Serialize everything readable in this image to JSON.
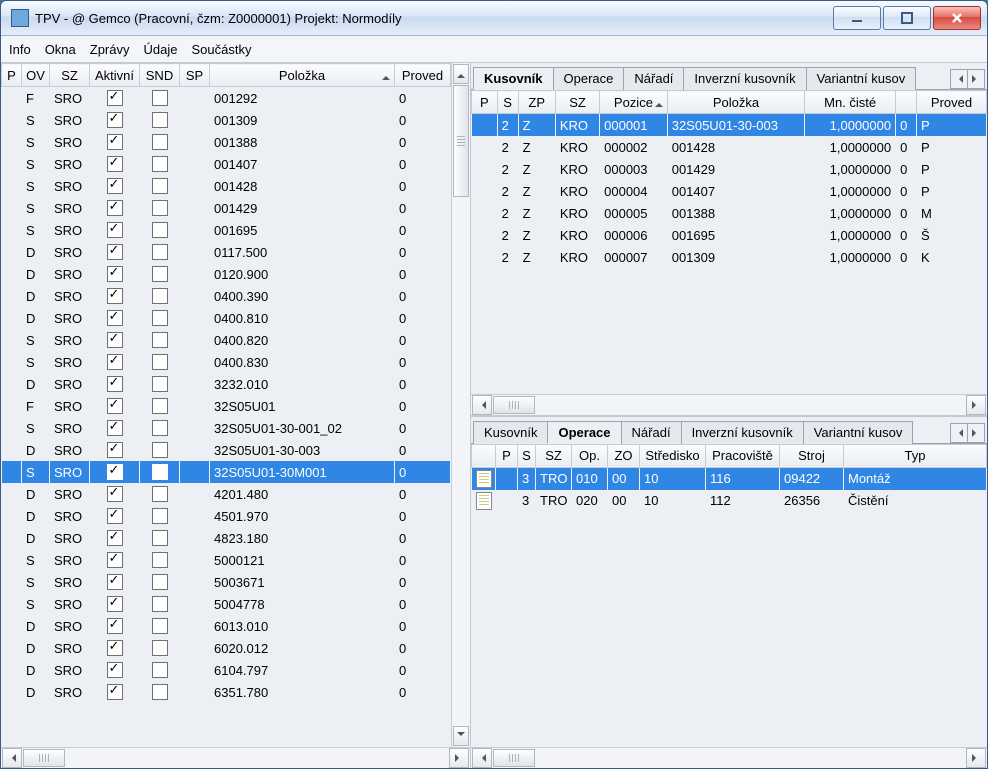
{
  "window": {
    "title": "TPV - @ Gemco (Pracovní, čzm: Z0000001) Projekt: Normodíly"
  },
  "menu": [
    "Info",
    "Okna",
    "Zprávy",
    "Údaje",
    "Součástky"
  ],
  "left": {
    "headers": [
      "P",
      "OV",
      "SZ",
      "Aktivní",
      "SND",
      "SP",
      "Položka",
      "Proved"
    ],
    "rows": [
      {
        "p": "",
        "ov": "F",
        "sz": "SRO",
        "akt": true,
        "snd": false,
        "sp": "",
        "polozka": "001292",
        "prov": "0"
      },
      {
        "p": "",
        "ov": "S",
        "sz": "SRO",
        "akt": true,
        "snd": false,
        "sp": "",
        "polozka": "001309",
        "prov": "0"
      },
      {
        "p": "",
        "ov": "S",
        "sz": "SRO",
        "akt": true,
        "snd": false,
        "sp": "",
        "polozka": "001388",
        "prov": "0"
      },
      {
        "p": "",
        "ov": "S",
        "sz": "SRO",
        "akt": true,
        "snd": false,
        "sp": "",
        "polozka": "001407",
        "prov": "0"
      },
      {
        "p": "",
        "ov": "S",
        "sz": "SRO",
        "akt": true,
        "snd": false,
        "sp": "",
        "polozka": "001428",
        "prov": "0"
      },
      {
        "p": "",
        "ov": "S",
        "sz": "SRO",
        "akt": true,
        "snd": false,
        "sp": "",
        "polozka": "001429",
        "prov": "0"
      },
      {
        "p": "",
        "ov": "S",
        "sz": "SRO",
        "akt": true,
        "snd": false,
        "sp": "",
        "polozka": "001695",
        "prov": "0"
      },
      {
        "p": "",
        "ov": "D",
        "sz": "SRO",
        "akt": true,
        "snd": false,
        "sp": "",
        "polozka": "0117.500",
        "prov": "0"
      },
      {
        "p": "",
        "ov": "D",
        "sz": "SRO",
        "akt": true,
        "snd": false,
        "sp": "",
        "polozka": "0120.900",
        "prov": "0"
      },
      {
        "p": "",
        "ov": "D",
        "sz": "SRO",
        "akt": true,
        "snd": false,
        "sp": "",
        "polozka": "0400.390",
        "prov": "0"
      },
      {
        "p": "",
        "ov": "D",
        "sz": "SRO",
        "akt": true,
        "snd": false,
        "sp": "",
        "polozka": "0400.810",
        "prov": "0"
      },
      {
        "p": "",
        "ov": "S",
        "sz": "SRO",
        "akt": true,
        "snd": false,
        "sp": "",
        "polozka": "0400.820",
        "prov": "0"
      },
      {
        "p": "",
        "ov": "S",
        "sz": "SRO",
        "akt": true,
        "snd": false,
        "sp": "",
        "polozka": "0400.830",
        "prov": "0"
      },
      {
        "p": "",
        "ov": "D",
        "sz": "SRO",
        "akt": true,
        "snd": false,
        "sp": "",
        "polozka": "3232.010",
        "prov": "0"
      },
      {
        "p": "",
        "ov": "F",
        "sz": "SRO",
        "akt": true,
        "snd": false,
        "sp": "",
        "polozka": "32S05U01",
        "prov": "0"
      },
      {
        "p": "",
        "ov": "S",
        "sz": "SRO",
        "akt": true,
        "snd": false,
        "sp": "",
        "polozka": "32S05U01-30-001_02",
        "prov": "0"
      },
      {
        "p": "",
        "ov": "D",
        "sz": "SRO",
        "akt": true,
        "snd": false,
        "sp": "",
        "polozka": "32S05U01-30-003",
        "prov": "0"
      },
      {
        "p": "",
        "ov": "S",
        "sz": "SRO",
        "akt": true,
        "snd": false,
        "sp": "",
        "polozka": "32S05U01-30M001",
        "prov": "0",
        "sel": true
      },
      {
        "p": "",
        "ov": "D",
        "sz": "SRO",
        "akt": true,
        "snd": false,
        "sp": "",
        "polozka": "4201.480",
        "prov": "0"
      },
      {
        "p": "",
        "ov": "D",
        "sz": "SRO",
        "akt": true,
        "snd": false,
        "sp": "",
        "polozka": "4501.970",
        "prov": "0"
      },
      {
        "p": "",
        "ov": "D",
        "sz": "SRO",
        "akt": true,
        "snd": false,
        "sp": "",
        "polozka": "4823.180",
        "prov": "0"
      },
      {
        "p": "",
        "ov": "S",
        "sz": "SRO",
        "akt": true,
        "snd": false,
        "sp": "",
        "polozka": "5000121",
        "prov": "0"
      },
      {
        "p": "",
        "ov": "S",
        "sz": "SRO",
        "akt": true,
        "snd": false,
        "sp": "",
        "polozka": "5003671",
        "prov": "0"
      },
      {
        "p": "",
        "ov": "S",
        "sz": "SRO",
        "akt": true,
        "snd": false,
        "sp": "",
        "polozka": "5004778",
        "prov": "0"
      },
      {
        "p": "",
        "ov": "D",
        "sz": "SRO",
        "akt": true,
        "snd": false,
        "sp": "",
        "polozka": "6013.010",
        "prov": "0"
      },
      {
        "p": "",
        "ov": "D",
        "sz": "SRO",
        "akt": true,
        "snd": false,
        "sp": "",
        "polozka": "6020.012",
        "prov": "0"
      },
      {
        "p": "",
        "ov": "D",
        "sz": "SRO",
        "akt": true,
        "snd": false,
        "sp": "",
        "polozka": "6104.797",
        "prov": "0"
      },
      {
        "p": "",
        "ov": "D",
        "sz": "SRO",
        "akt": true,
        "snd": false,
        "sp": "",
        "polozka": "6351.780",
        "prov": "0"
      }
    ]
  },
  "rightTop": {
    "tabs": [
      "Kusovník",
      "Operace",
      "Nářadí",
      "Inverzní kusovník",
      "Variantní kusov"
    ],
    "activeTab": 0,
    "headers": [
      "P",
      "S",
      "ZP",
      "SZ",
      "Pozice",
      "Položka",
      "Mn. čisté",
      "",
      "Proved"
    ],
    "rows": [
      {
        "p": "",
        "s": "2",
        "zp": "Z",
        "sz": "KRO",
        "poz": "000001",
        "pol": "32S05U01-30-003",
        "mn": "1,0000000",
        "c2": "0",
        "prov": "P",
        "sel": true
      },
      {
        "p": "",
        "s": "2",
        "zp": "Z",
        "sz": "KRO",
        "poz": "000002",
        "pol": "001428",
        "mn": "1,0000000",
        "c2": "0",
        "prov": "P"
      },
      {
        "p": "",
        "s": "2",
        "zp": "Z",
        "sz": "KRO",
        "poz": "000003",
        "pol": "001429",
        "mn": "1,0000000",
        "c2": "0",
        "prov": "P"
      },
      {
        "p": "",
        "s": "2",
        "zp": "Z",
        "sz": "KRO",
        "poz": "000004",
        "pol": "001407",
        "mn": "1,0000000",
        "c2": "0",
        "prov": "P"
      },
      {
        "p": "",
        "s": "2",
        "zp": "Z",
        "sz": "KRO",
        "poz": "000005",
        "pol": "001388",
        "mn": "1,0000000",
        "c2": "0",
        "prov": "M"
      },
      {
        "p": "",
        "s": "2",
        "zp": "Z",
        "sz": "KRO",
        "poz": "000006",
        "pol": "001695",
        "mn": "1,0000000",
        "c2": "0",
        "prov": "Š"
      },
      {
        "p": "",
        "s": "2",
        "zp": "Z",
        "sz": "KRO",
        "poz": "000007",
        "pol": "001309",
        "mn": "1,0000000",
        "c2": "0",
        "prov": "K"
      }
    ]
  },
  "rightBottom": {
    "tabs": [
      "Kusovník",
      "Operace",
      "Nářadí",
      "Inverzní kusovník",
      "Variantní kusov"
    ],
    "activeTab": 1,
    "headers": [
      "",
      "P",
      "S",
      "SZ",
      "Op.",
      "ZO",
      "Středisko",
      "Pracoviště",
      "Stroj",
      "Typ"
    ],
    "rows": [
      {
        "ic": true,
        "p": "",
        "s": "3",
        "sz": "TRO",
        "op": "010",
        "zo": "00",
        "str": "10",
        "prac": "116",
        "stroj": "09422",
        "typ": "Montáž",
        "sel": true
      },
      {
        "ic": true,
        "p": "",
        "s": "3",
        "sz": "TRO",
        "op": "020",
        "zo": "00",
        "str": "10",
        "prac": "112",
        "stroj": "26356",
        "typ": "Čistění"
      }
    ]
  }
}
